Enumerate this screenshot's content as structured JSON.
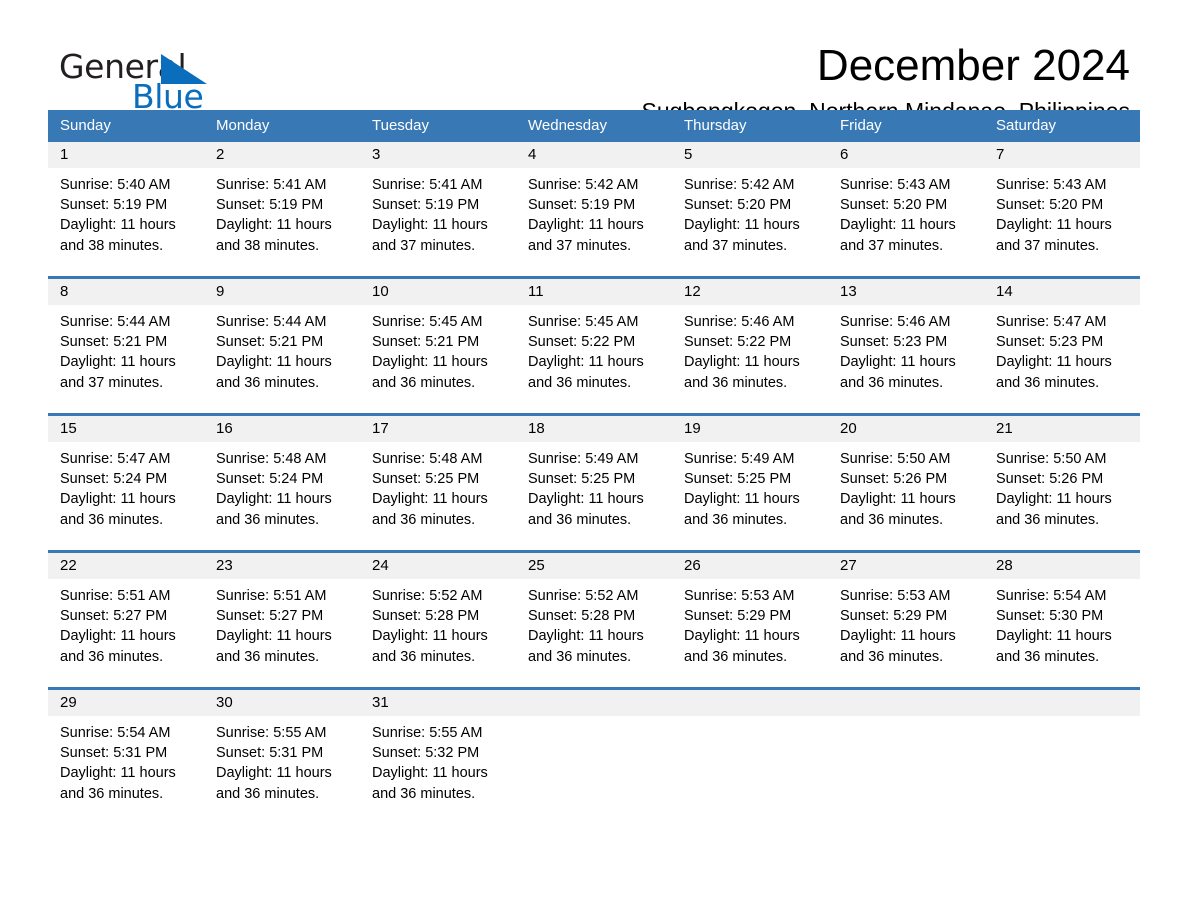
{
  "brand": {
    "word_one": "General",
    "word_two": "Blue",
    "triangle_color": "#0a6ebd",
    "accent_color": "#3878b4"
  },
  "header": {
    "title": "December 2024",
    "location": "Sugbongkogon, Northern Mindanao, Philippines"
  },
  "calendar": {
    "weekdays": [
      "Sunday",
      "Monday",
      "Tuesday",
      "Wednesday",
      "Thursday",
      "Friday",
      "Saturday"
    ],
    "weeks": [
      [
        {
          "day": "1",
          "lines": [
            "Sunrise: 5:40 AM",
            "Sunset: 5:19 PM",
            "Daylight: 11 hours",
            "and 38 minutes."
          ]
        },
        {
          "day": "2",
          "lines": [
            "Sunrise: 5:41 AM",
            "Sunset: 5:19 PM",
            "Daylight: 11 hours",
            "and 38 minutes."
          ]
        },
        {
          "day": "3",
          "lines": [
            "Sunrise: 5:41 AM",
            "Sunset: 5:19 PM",
            "Daylight: 11 hours",
            "and 37 minutes."
          ]
        },
        {
          "day": "4",
          "lines": [
            "Sunrise: 5:42 AM",
            "Sunset: 5:19 PM",
            "Daylight: 11 hours",
            "and 37 minutes."
          ]
        },
        {
          "day": "5",
          "lines": [
            "Sunrise: 5:42 AM",
            "Sunset: 5:20 PM",
            "Daylight: 11 hours",
            "and 37 minutes."
          ]
        },
        {
          "day": "6",
          "lines": [
            "Sunrise: 5:43 AM",
            "Sunset: 5:20 PM",
            "Daylight: 11 hours",
            "and 37 minutes."
          ]
        },
        {
          "day": "7",
          "lines": [
            "Sunrise: 5:43 AM",
            "Sunset: 5:20 PM",
            "Daylight: 11 hours",
            "and 37 minutes."
          ]
        }
      ],
      [
        {
          "day": "8",
          "lines": [
            "Sunrise: 5:44 AM",
            "Sunset: 5:21 PM",
            "Daylight: 11 hours",
            "and 37 minutes."
          ]
        },
        {
          "day": "9",
          "lines": [
            "Sunrise: 5:44 AM",
            "Sunset: 5:21 PM",
            "Daylight: 11 hours",
            "and 36 minutes."
          ]
        },
        {
          "day": "10",
          "lines": [
            "Sunrise: 5:45 AM",
            "Sunset: 5:21 PM",
            "Daylight: 11 hours",
            "and 36 minutes."
          ]
        },
        {
          "day": "11",
          "lines": [
            "Sunrise: 5:45 AM",
            "Sunset: 5:22 PM",
            "Daylight: 11 hours",
            "and 36 minutes."
          ]
        },
        {
          "day": "12",
          "lines": [
            "Sunrise: 5:46 AM",
            "Sunset: 5:22 PM",
            "Daylight: 11 hours",
            "and 36 minutes."
          ]
        },
        {
          "day": "13",
          "lines": [
            "Sunrise: 5:46 AM",
            "Sunset: 5:23 PM",
            "Daylight: 11 hours",
            "and 36 minutes."
          ]
        },
        {
          "day": "14",
          "lines": [
            "Sunrise: 5:47 AM",
            "Sunset: 5:23 PM",
            "Daylight: 11 hours",
            "and 36 minutes."
          ]
        }
      ],
      [
        {
          "day": "15",
          "lines": [
            "Sunrise: 5:47 AM",
            "Sunset: 5:24 PM",
            "Daylight: 11 hours",
            "and 36 minutes."
          ]
        },
        {
          "day": "16",
          "lines": [
            "Sunrise: 5:48 AM",
            "Sunset: 5:24 PM",
            "Daylight: 11 hours",
            "and 36 minutes."
          ]
        },
        {
          "day": "17",
          "lines": [
            "Sunrise: 5:48 AM",
            "Sunset: 5:25 PM",
            "Daylight: 11 hours",
            "and 36 minutes."
          ]
        },
        {
          "day": "18",
          "lines": [
            "Sunrise: 5:49 AM",
            "Sunset: 5:25 PM",
            "Daylight: 11 hours",
            "and 36 minutes."
          ]
        },
        {
          "day": "19",
          "lines": [
            "Sunrise: 5:49 AM",
            "Sunset: 5:25 PM",
            "Daylight: 11 hours",
            "and 36 minutes."
          ]
        },
        {
          "day": "20",
          "lines": [
            "Sunrise: 5:50 AM",
            "Sunset: 5:26 PM",
            "Daylight: 11 hours",
            "and 36 minutes."
          ]
        },
        {
          "day": "21",
          "lines": [
            "Sunrise: 5:50 AM",
            "Sunset: 5:26 PM",
            "Daylight: 11 hours",
            "and 36 minutes."
          ]
        }
      ],
      [
        {
          "day": "22",
          "lines": [
            "Sunrise: 5:51 AM",
            "Sunset: 5:27 PM",
            "Daylight: 11 hours",
            "and 36 minutes."
          ]
        },
        {
          "day": "23",
          "lines": [
            "Sunrise: 5:51 AM",
            "Sunset: 5:27 PM",
            "Daylight: 11 hours",
            "and 36 minutes."
          ]
        },
        {
          "day": "24",
          "lines": [
            "Sunrise: 5:52 AM",
            "Sunset: 5:28 PM",
            "Daylight: 11 hours",
            "and 36 minutes."
          ]
        },
        {
          "day": "25",
          "lines": [
            "Sunrise: 5:52 AM",
            "Sunset: 5:28 PM",
            "Daylight: 11 hours",
            "and 36 minutes."
          ]
        },
        {
          "day": "26",
          "lines": [
            "Sunrise: 5:53 AM",
            "Sunset: 5:29 PM",
            "Daylight: 11 hours",
            "and 36 minutes."
          ]
        },
        {
          "day": "27",
          "lines": [
            "Sunrise: 5:53 AM",
            "Sunset: 5:29 PM",
            "Daylight: 11 hours",
            "and 36 minutes."
          ]
        },
        {
          "day": "28",
          "lines": [
            "Sunrise: 5:54 AM",
            "Sunset: 5:30 PM",
            "Daylight: 11 hours",
            "and 36 minutes."
          ]
        }
      ],
      [
        {
          "day": "29",
          "lines": [
            "Sunrise: 5:54 AM",
            "Sunset: 5:31 PM",
            "Daylight: 11 hours",
            "and 36 minutes."
          ]
        },
        {
          "day": "30",
          "lines": [
            "Sunrise: 5:55 AM",
            "Sunset: 5:31 PM",
            "Daylight: 11 hours",
            "and 36 minutes."
          ]
        },
        {
          "day": "31",
          "lines": [
            "Sunrise: 5:55 AM",
            "Sunset: 5:32 PM",
            "Daylight: 11 hours",
            "and 36 minutes."
          ]
        },
        {
          "day": "",
          "lines": []
        },
        {
          "day": "",
          "lines": []
        },
        {
          "day": "",
          "lines": []
        },
        {
          "day": "",
          "lines": []
        }
      ]
    ]
  }
}
